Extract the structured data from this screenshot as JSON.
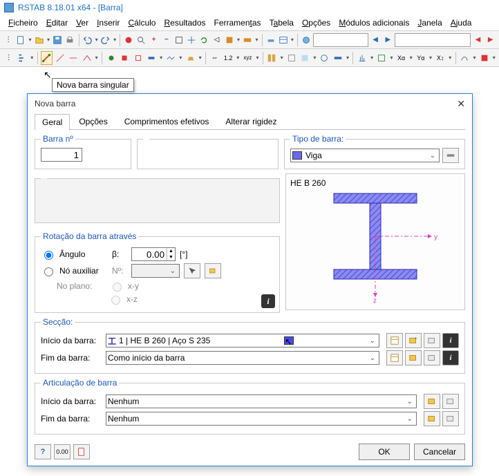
{
  "title": "RSTAB 8.18.01 x64 - [Barra]",
  "menu": [
    "Ficheiro",
    "Editar",
    "Ver",
    "Inserir",
    "Cálculo",
    "Resultados",
    "Ferramentas",
    "Tabela",
    "Opções",
    "Módulos adicionais",
    "Janela",
    "Ajuda"
  ],
  "tooltip": "Nova barra singular",
  "dialog": {
    "title": "Nova barra",
    "tabs": [
      "Geral",
      "Opções",
      "Comprimentos efetivos",
      "Alterar rigidez"
    ],
    "active_tab": 0,
    "barra_no_label": "Barra nº",
    "barra_no_value": "1",
    "tipo_label": "Tipo de barra:",
    "tipo_value": "Viga",
    "preview_name": "HE B 260",
    "rot_legend": "Rotação da barra através",
    "rot_angle_label": "Ângulo",
    "rot_beta_label": "β:",
    "rot_angle_value": "0.00",
    "rot_unit": "[°]",
    "rot_aux_label": "Nó auxiliar",
    "rot_aux_no_label": "Nº:",
    "rot_plano_label": "No plano:",
    "rot_plano_xy": "x-y",
    "rot_plano_xz": "x-z",
    "sec_legend": "Secção:",
    "sec_inicio_label": "Início da barra:",
    "sec_inicio_value": "1 | HE B 260 | Aço S 235",
    "sec_fim_label": "Fim da barra:",
    "sec_fim_value": "Como início da barra",
    "art_legend": "Articulação de barra",
    "art_inicio_label": "Início da barra:",
    "art_inicio_value": "Nenhum",
    "art_fim_label": "Fim da barra:",
    "art_fim_value": "Nenhum",
    "ok": "OK",
    "cancel": "Cancelar"
  },
  "axis": {
    "y": "y",
    "z": "z"
  },
  "chart_data": null
}
